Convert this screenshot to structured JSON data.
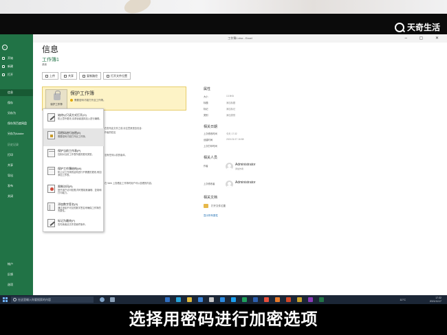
{
  "watermark": {
    "text": "天奇生活",
    "icon": "magnifier-logo-icon"
  },
  "window": {
    "title": "工作簿1.xlsx - Excel"
  },
  "sidebar": {
    "items": [
      {
        "label": "开始",
        "icon": "home-icon"
      },
      {
        "label": "新建",
        "icon": "new-file-icon"
      },
      {
        "label": "打开",
        "icon": "open-folder-icon"
      },
      {
        "label": "信息",
        "active": true
      },
      {
        "label": "保存"
      },
      {
        "label": "另存为"
      },
      {
        "label": "保存到百度网盘"
      },
      {
        "label": "另存为Adobe"
      },
      {
        "label": "历史记录",
        "dimmed": true
      },
      {
        "label": "打印"
      },
      {
        "label": "共享"
      },
      {
        "label": "导出"
      },
      {
        "label": "发布"
      },
      {
        "label": "关闭"
      }
    ],
    "bottom_items": [
      {
        "label": "帐户"
      },
      {
        "label": "反馈"
      },
      {
        "label": "选项"
      }
    ]
  },
  "page": {
    "title": "信息",
    "workbook_name": "工作簿1",
    "path": "桌面"
  },
  "toolbar": {
    "buttons": [
      {
        "label": "上传"
      },
      {
        "label": "共享"
      },
      {
        "label": "复制路径"
      },
      {
        "label": "打开文件位置"
      }
    ]
  },
  "protect": {
    "tile_label": "保护工作簿",
    "title": "保护工作簿",
    "description": "需要密码才能打开此工作簿。"
  },
  "protect_menu": {
    "items": [
      {
        "title": "始终以只读方式打开(O)",
        "description": "防止意外更改,请求读者选择加入进行编辑。",
        "icon": "pen-icon"
      },
      {
        "title": "用密码进行加密(E)",
        "description": "需要密码才能打开此工作簿。",
        "icon": "lock-icon"
      },
      {
        "title": "保护当前工作表(P)",
        "description": "控制对当前工作表所做的更改类型。",
        "icon": "sheet-icon"
      },
      {
        "title": "保护工作簿结构(W)",
        "description": "防止对工作簿的结构进行不需要的更改,例如添加工作表。",
        "icon": "workbook-structure-icon"
      },
      {
        "title": "限制访问(R)",
        "description": "授予用户访问权限,同时限制其编辑、复制和打印能力。",
        "icon": "restrict-access-icon"
      },
      {
        "title": "添加数字签名(S)",
        "description": "通过添加不可见的数字签名来确保工作簿的完整性。",
        "icon": "signature-icon"
      },
      {
        "title": "标记为最终(F)",
        "description": "告知读者此文件是最终版本。",
        "icon": "mark-final-icon"
      }
    ]
  },
  "background_text": {
    "inspect_line1": "在发布此文件之前,请注意其是否包含:",
    "inspect_line2": "作者的姓名",
    "versions_line1": "没有任何以前的版本。",
    "browser_line1": "在 Web 上查看此工作簿时用户可以查看的内容。"
  },
  "properties": {
    "header": "属性",
    "rows": [
      {
        "label": "大小",
        "value": "13.9KB"
      },
      {
        "label": "标题",
        "value": "添加标题"
      },
      {
        "label": "标记",
        "value": "添加标记"
      },
      {
        "label": "类别",
        "value": "添加类别"
      }
    ],
    "dates_header": "相关日期",
    "dates": [
      {
        "label": "上次修改时间",
        "value": "今天 17:32"
      },
      {
        "label": "创建时间",
        "value": "2021/11/17 16:58"
      },
      {
        "label": "上次打印时间",
        "value": ""
      }
    ],
    "people_header": "相关人员",
    "author_label": "作者",
    "author_name": "Administrator",
    "author_sub": "添加作者",
    "modifier_label": "上次修改者",
    "modifier_name": "Administrator",
    "docs_header": "相关文档",
    "open_location": "打开文件位置",
    "show_all": "显示所有属性"
  },
  "taskbar": {
    "search_placeholder": "在这里输入你要搜索的内容",
    "temperature": "11°C",
    "time": "17:32",
    "date": "2021/11/17"
  },
  "subtitle": {
    "text": "选择用密码进行加密选项"
  }
}
